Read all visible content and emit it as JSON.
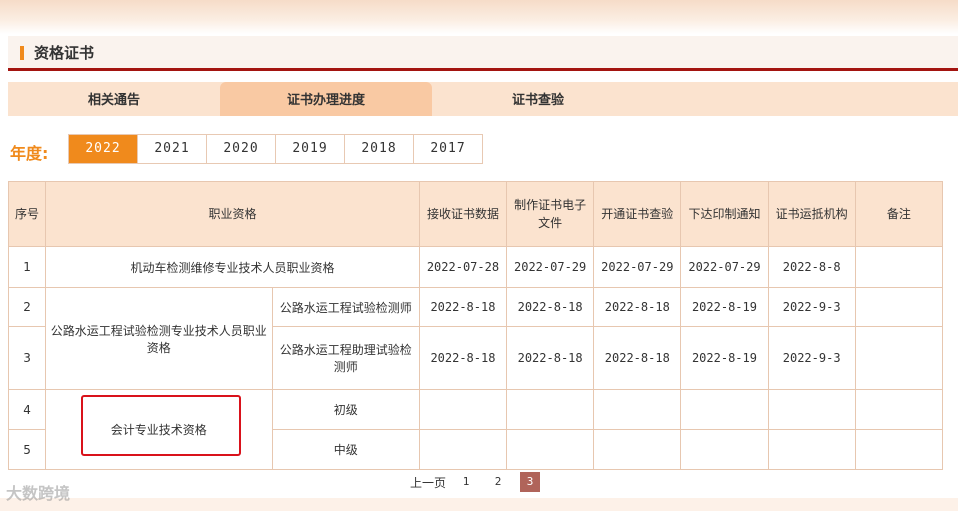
{
  "section": {
    "title": "资格证书"
  },
  "tabs": [
    {
      "label": "相关通告",
      "active": false
    },
    {
      "label": "证书办理进度",
      "active": true
    },
    {
      "label": "证书查验",
      "active": false
    }
  ],
  "year_filter": {
    "label": "年度:",
    "years": [
      "2022",
      "2021",
      "2020",
      "2019",
      "2018",
      "2017"
    ],
    "selected": "2022"
  },
  "table": {
    "headers": {
      "seq": "序号",
      "qualification": "职业资格",
      "receive": "接收证书数据",
      "make": "制作证书电子文件",
      "open": "开通证书查验",
      "print": "下达印制通知",
      "deliver": "证书运抵机构",
      "remark": "备注"
    },
    "rows": [
      {
        "seq": "1",
        "qualification": "机动车检测维修专业技术人员职业资格",
        "sub": "",
        "receive": "2022-07-28",
        "make": "2022-07-29",
        "open": "2022-07-29",
        "print": "2022-07-29",
        "deliver": "2022-8-8",
        "remark": ""
      },
      {
        "seq": "2",
        "qualification": "公路水运工程试验检测专业技术人员职业资格",
        "sub": "公路水运工程试验检测师",
        "receive": "2022-8-18",
        "make": "2022-8-18",
        "open": "2022-8-18",
        "print": "2022-8-19",
        "deliver": "2022-9-3",
        "remark": ""
      },
      {
        "seq": "3",
        "qualification": "",
        "sub": "公路水运工程助理试验检测师",
        "receive": "2022-8-18",
        "make": "2022-8-18",
        "open": "2022-8-18",
        "print": "2022-8-19",
        "deliver": "2022-9-3",
        "remark": ""
      },
      {
        "seq": "4",
        "qualification": "会计专业技术资格",
        "sub": "初级",
        "receive": "",
        "make": "",
        "open": "",
        "print": "",
        "deliver": "",
        "remark": ""
      },
      {
        "seq": "5",
        "qualification": "",
        "sub": "中级",
        "receive": "",
        "make": "",
        "open": "",
        "print": "",
        "deliver": "",
        "remark": ""
      }
    ]
  },
  "pager": {
    "prev_label": "上一页",
    "pages": [
      "1",
      "2",
      "3"
    ],
    "current": "3"
  },
  "watermark": "大数跨境",
  "colors": {
    "accent": "#f08a1c",
    "header_rule": "#a31410",
    "tab_bg": "#fbe3cf",
    "highlight": "#d9121b"
  }
}
